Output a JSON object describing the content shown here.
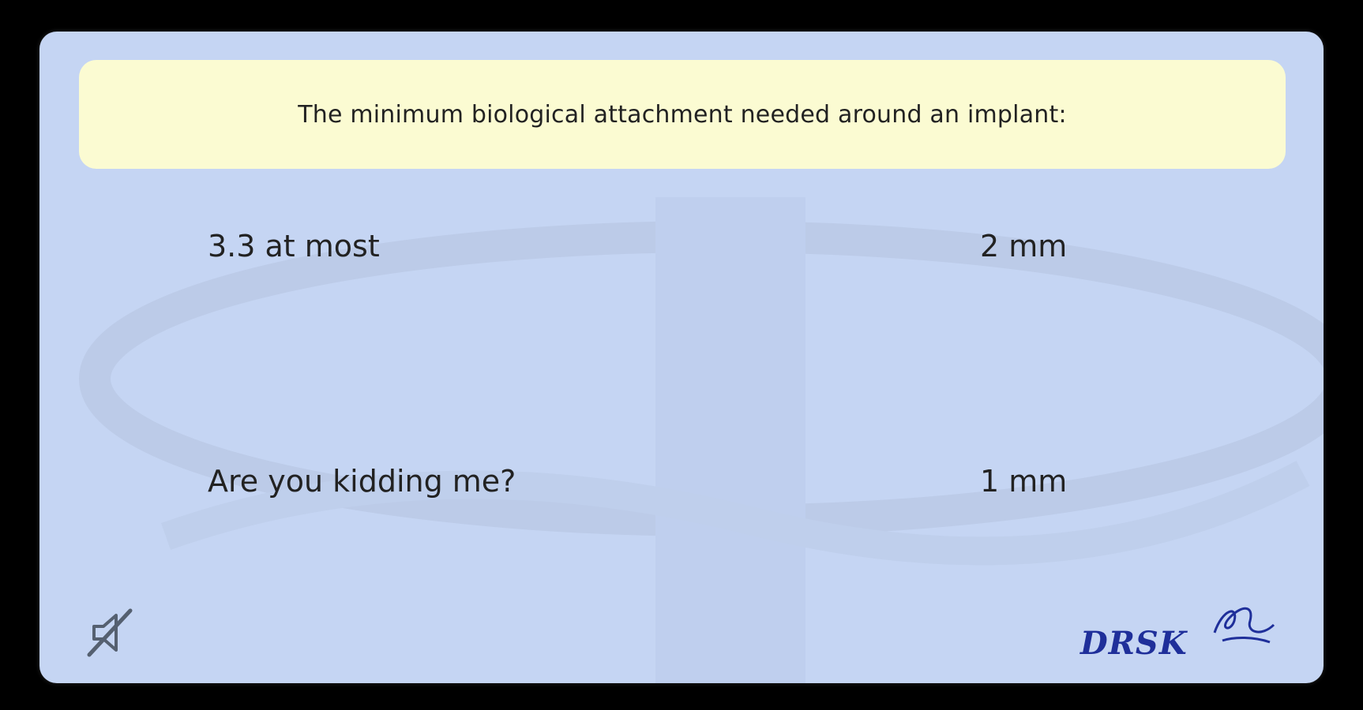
{
  "question": {
    "text": "The minimum biological attachment needed around an implant:"
  },
  "answers": [
    {
      "label": "3.3 at most"
    },
    {
      "label": "2 mm"
    },
    {
      "label": "Are you kidding me?"
    },
    {
      "label": "1 mm"
    }
  ],
  "footer": {
    "mute_icon": "speaker-muted-icon",
    "logo_text": "DRSK"
  },
  "colors": {
    "card_background": "#c5d5f3",
    "question_background": "#fbfbd2",
    "logo_color": "#1f2f9a"
  }
}
